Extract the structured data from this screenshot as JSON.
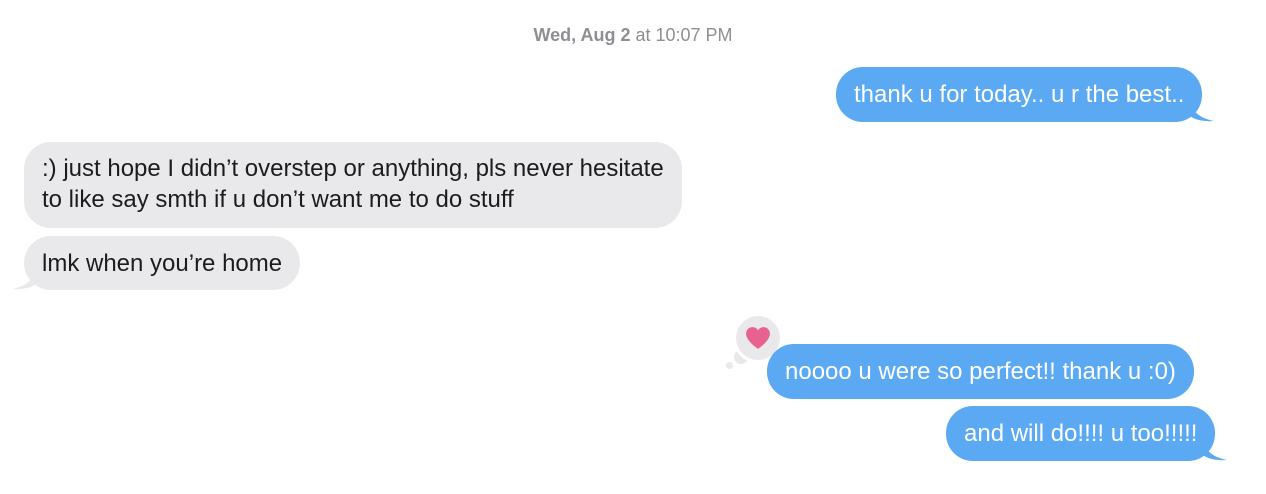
{
  "conversation": {
    "timestamp_day": "Wed, Aug 2",
    "timestamp_time": " at 10:07 PM",
    "messages": [
      {
        "direction": "sent",
        "text": "thank u for today.. u r the best.."
      },
      {
        "direction": "received",
        "lines": [
          ":) just hope I didn’t overstep or anything, pls never hesitate",
          "to like say smth if u don’t want me to do stuff"
        ]
      },
      {
        "direction": "received",
        "text": "lmk when you’re home"
      },
      {
        "direction": "sent",
        "text": "noooo u were so perfect!! thank u :0)",
        "reaction": "heart-icon"
      },
      {
        "direction": "sent",
        "text": "and will do!!!! u too!!!!!"
      }
    ]
  },
  "colors": {
    "sent_bubble": "#5aa9f2",
    "received_bubble": "#e9e9eb",
    "reaction_heart": "#e8628f",
    "timestamp": "#8e8e93"
  }
}
